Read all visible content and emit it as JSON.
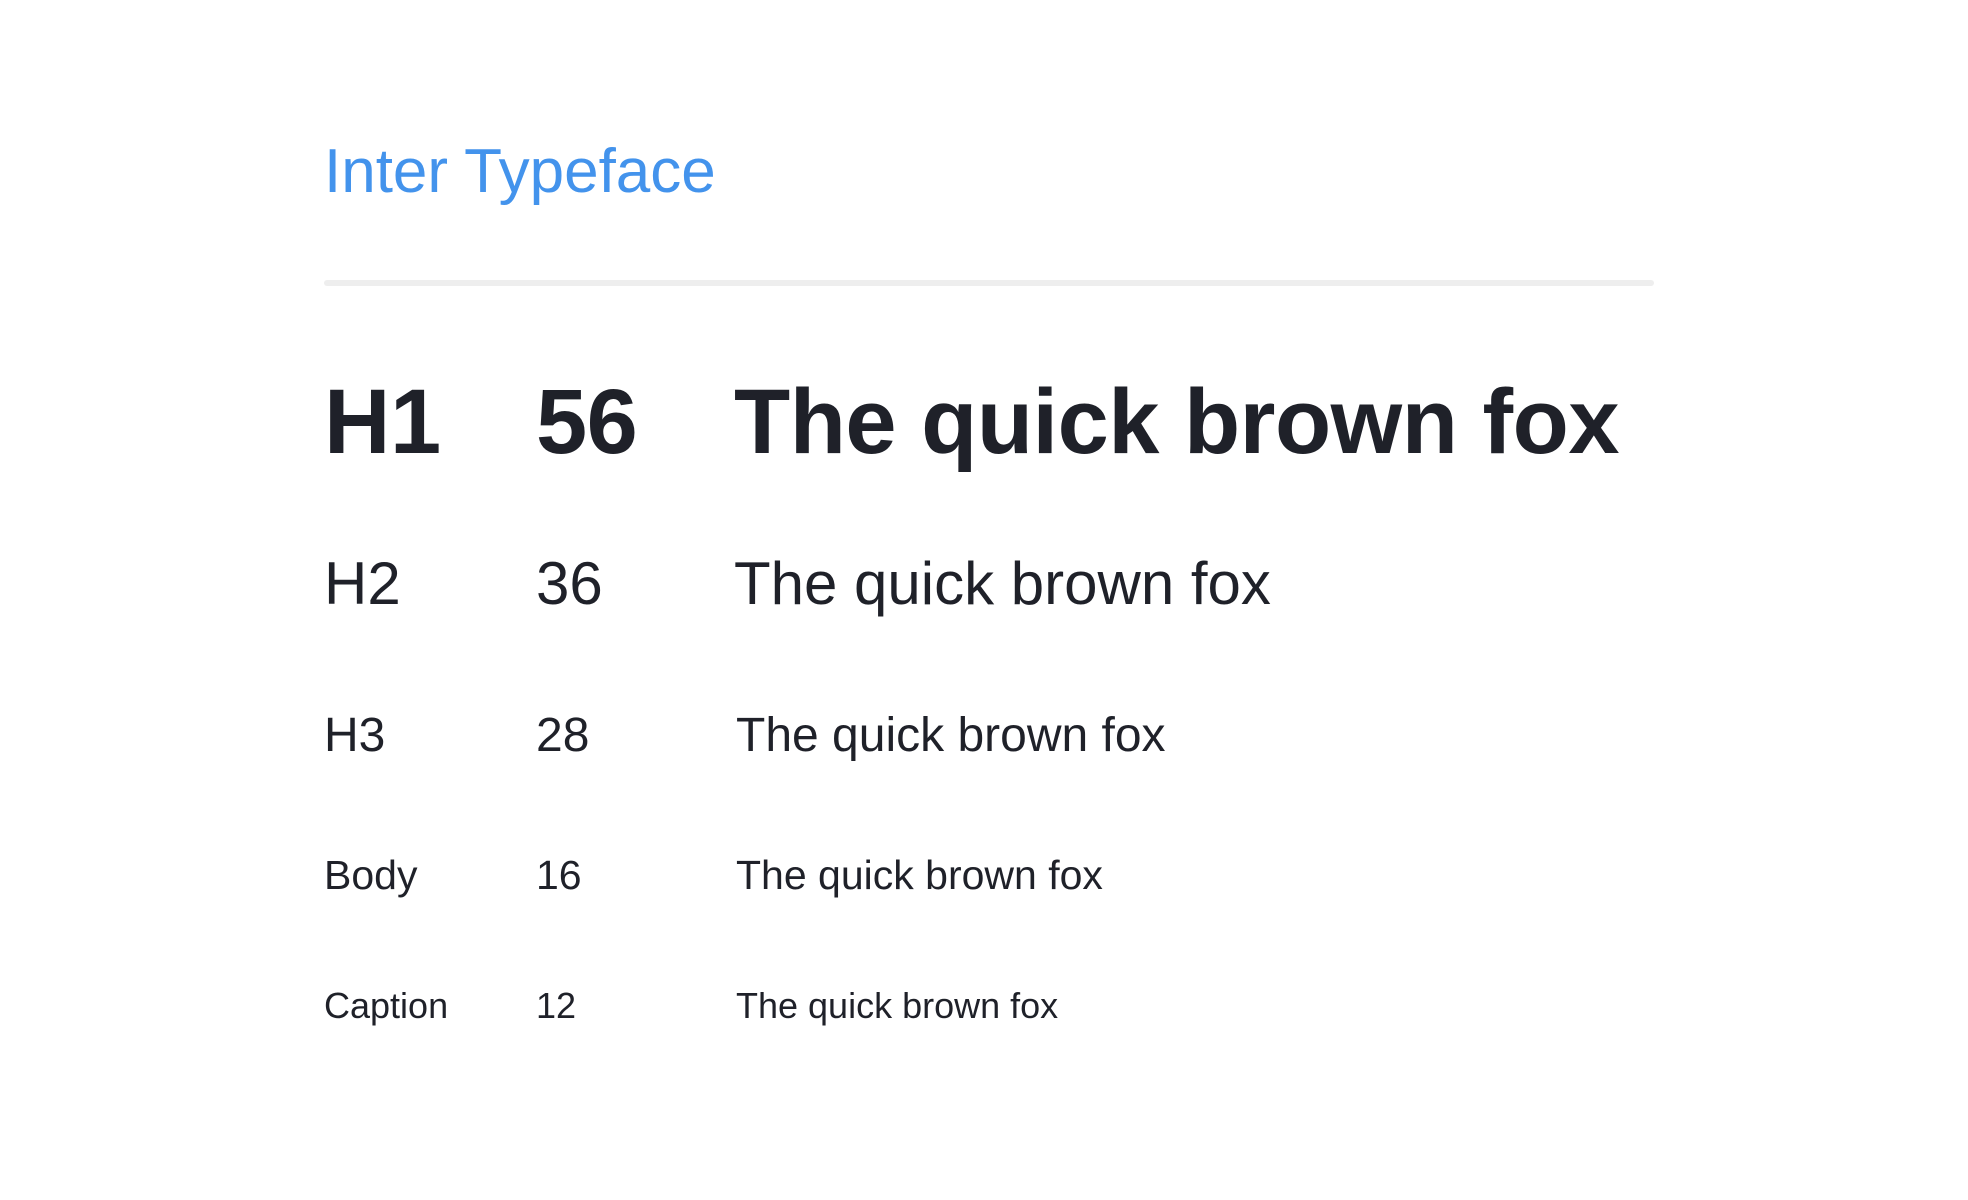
{
  "header": {
    "title": "Inter Typeface"
  },
  "type_scale": [
    {
      "style": "H1",
      "size": "56",
      "sample": "The quick brown fox"
    },
    {
      "style": "H2",
      "size": "36",
      "sample": "The quick brown fox"
    },
    {
      "style": "H3",
      "size": "28",
      "sample": "The quick brown fox"
    },
    {
      "style": "Body",
      "size": "16",
      "sample": "The quick brown fox"
    },
    {
      "style": "Caption",
      "size": "12",
      "sample": "The quick brown fox"
    }
  ],
  "colors": {
    "title": "#4393ec",
    "text": "#1f2129",
    "divider": "#eeeeee",
    "background": "#ffffff"
  }
}
